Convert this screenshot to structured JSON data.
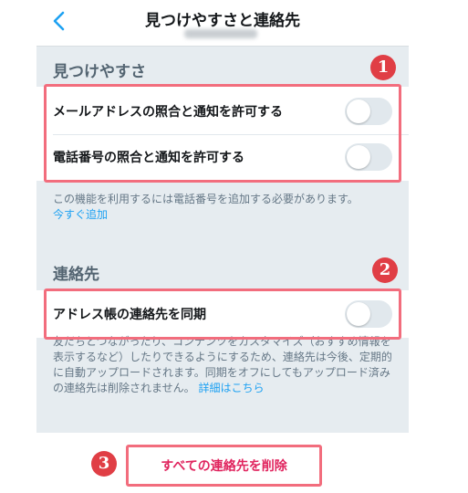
{
  "header": {
    "title": "見つけやすさと連絡先",
    "back_icon": "chevron-left-icon"
  },
  "discoverability": {
    "section_title": "見つけやすさ",
    "items": [
      {
        "label": "メールアドレスの照合と通知を許可する",
        "enabled": false
      },
      {
        "label": "電話番号の照合と通知を許可する",
        "enabled": false
      }
    ],
    "note": "この機能を利用するには電話番号を追加する必要があります。",
    "note_link": "今すぐ追加"
  },
  "contacts": {
    "section_title": "連絡先",
    "sync_label": "アドレス帳の連絡先を同期",
    "sync_enabled": false,
    "note": "友だちとつながったり、コンテンツをカスタマイズ（おすすめ情報を表示するなど）したりできるようにするため、連絡先は今後、定期的に自動アップロードされます。同期をオフにしてもアップロード済みの連絡先は削除されません。",
    "note_link": "詳細はこちら"
  },
  "delete_button": "すべての連絡先を削除",
  "annotations": {
    "badge_1": "1",
    "badge_2": "2",
    "badge_3": "3",
    "highlight_color": "#f26d7d",
    "badge_color": "#e03e45"
  },
  "colors": {
    "link": "#1da1f2",
    "danger_text": "#e0245e",
    "background": "#e6ecf0"
  }
}
